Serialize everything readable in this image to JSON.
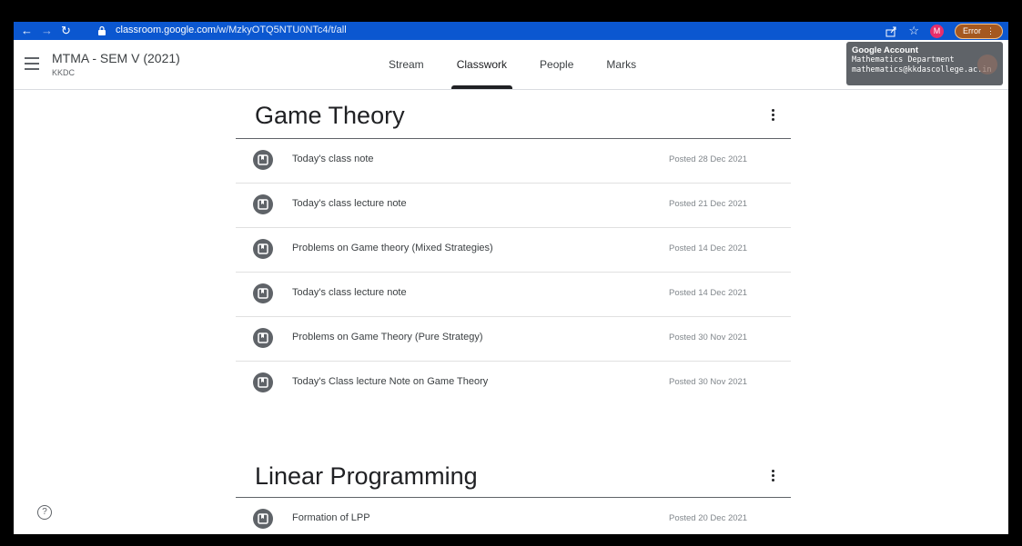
{
  "browser": {
    "url_host": "classroom.google.com",
    "url_path": "/w/MzkyOTQ5NTU0NTc4/t/all",
    "profile_initial": "M",
    "error_label": "Error"
  },
  "header": {
    "class_name": "MTMA - SEM V (2021)",
    "section": "KKDC",
    "tabs": [
      "Stream",
      "Classwork",
      "People",
      "Marks"
    ],
    "active_tab": "Classwork"
  },
  "account_tooltip": {
    "title": "Google Account",
    "name": "Mathematics Department",
    "email": "mathematics@kkdascollege.ac.in"
  },
  "topics": [
    {
      "name": "Game Theory",
      "items": [
        {
          "title": "Today's class note",
          "date": "Posted 28 Dec 2021"
        },
        {
          "title": "Today's class lecture note",
          "date": "Posted 21 Dec 2021"
        },
        {
          "title": "Problems on Game theory (Mixed Strategies)",
          "date": "Posted 14 Dec 2021"
        },
        {
          "title": "Today's class lecture note",
          "date": "Posted 14 Dec 2021"
        },
        {
          "title": "Problems on Game Theory (Pure Strategy)",
          "date": "Posted 30 Nov 2021"
        },
        {
          "title": "Today's Class lecture Note on Game Theory",
          "date": "Posted 30 Nov 2021"
        }
      ]
    },
    {
      "name": "Linear Programming",
      "items": [
        {
          "title": "Formation of LPP",
          "date": "Posted 20 Dec 2021"
        }
      ]
    }
  ],
  "icons": {
    "material": "material-icon",
    "more": "more-vert-icon",
    "help": "help-icon"
  }
}
